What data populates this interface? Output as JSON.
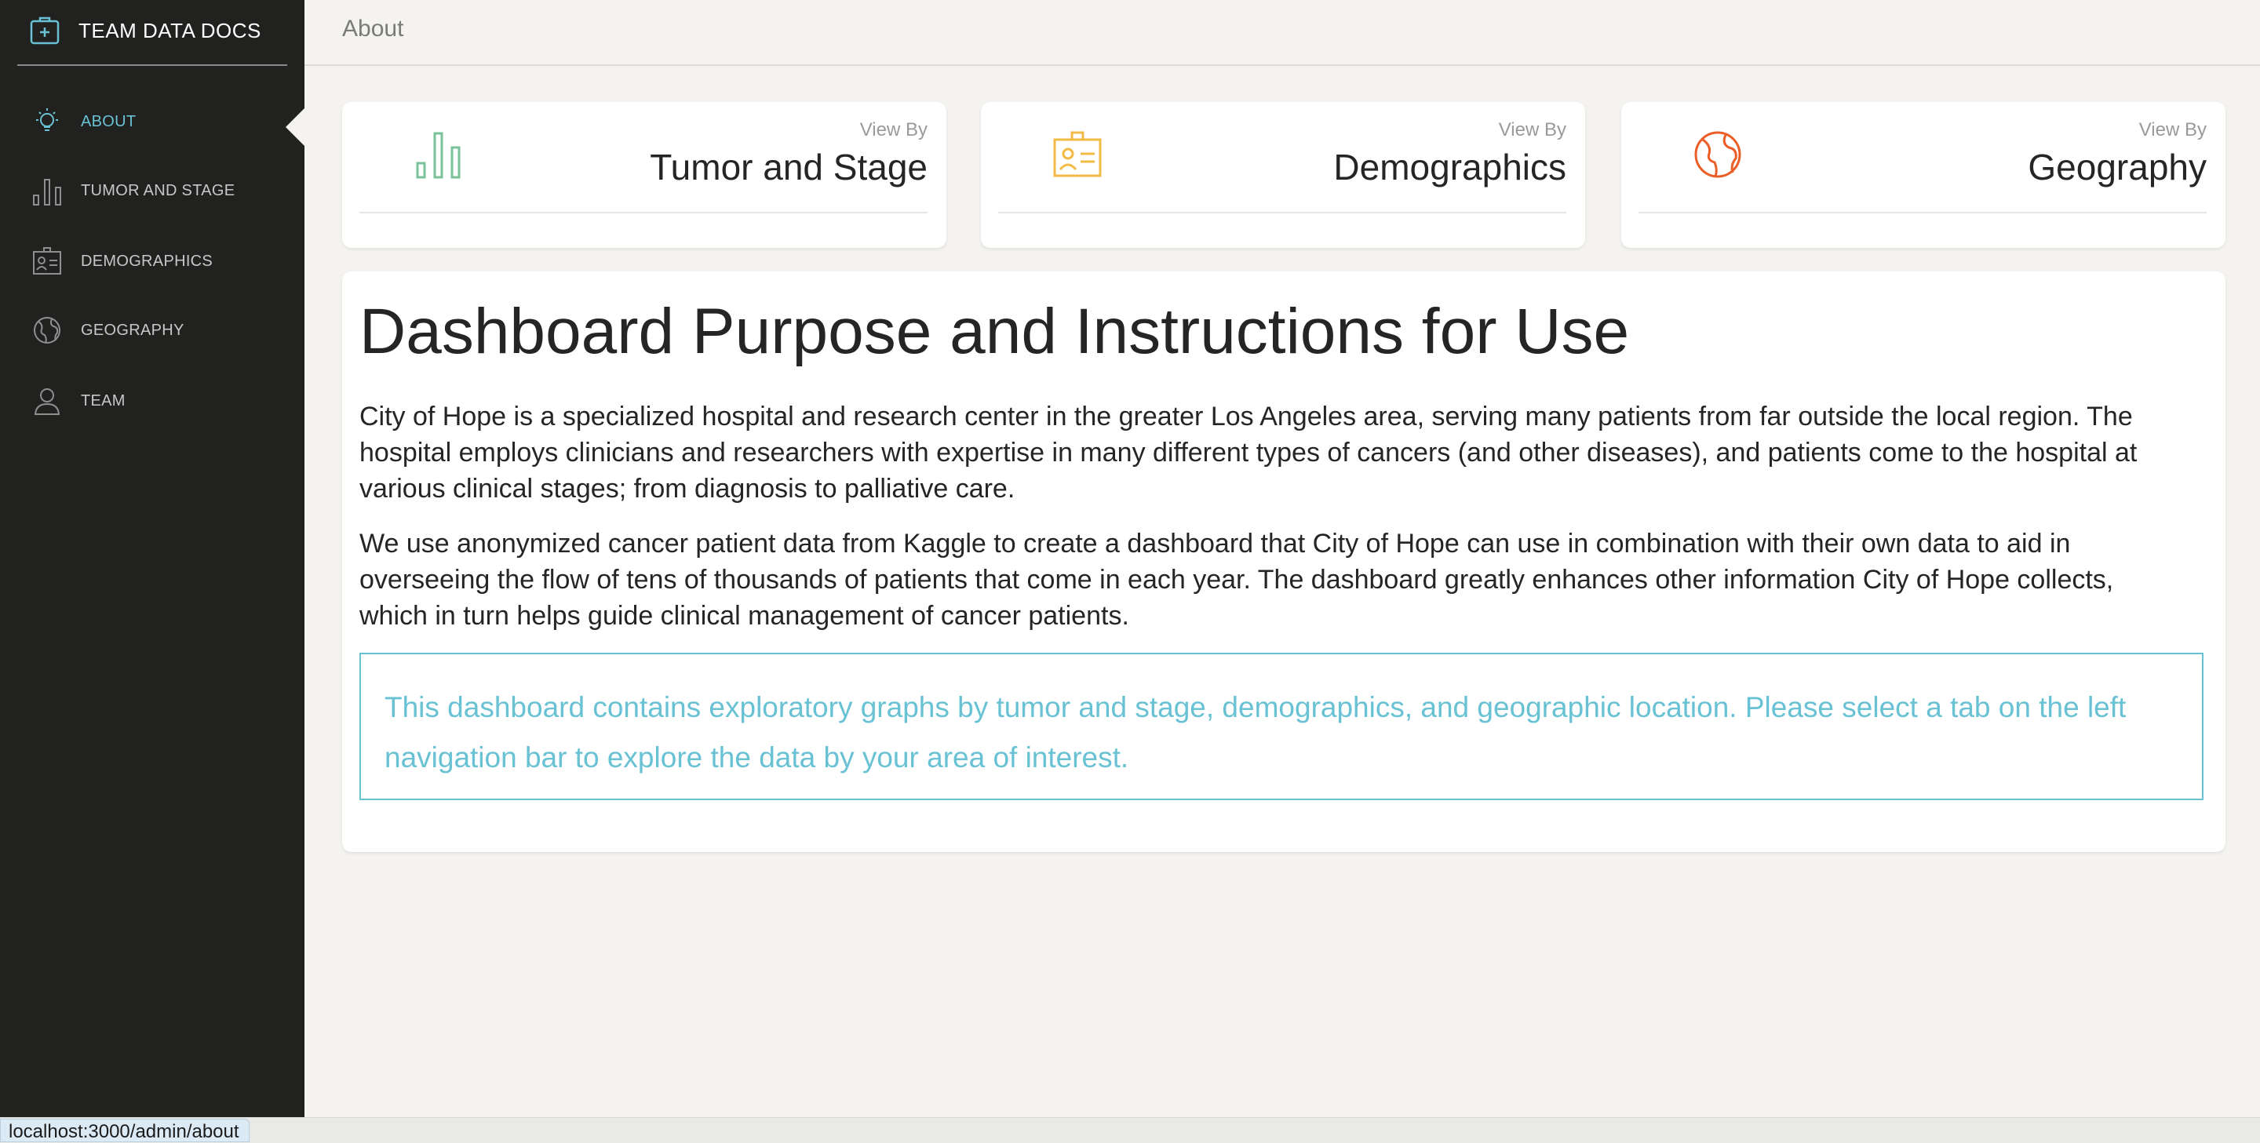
{
  "brand": {
    "name": "TEAM DATA DOCS",
    "icon": "medical-kit-icon"
  },
  "sidebar": {
    "items": [
      {
        "label": "ABOUT",
        "icon": "lightbulb-icon",
        "active": true
      },
      {
        "label": "TUMOR AND STAGE",
        "icon": "bar-chart-icon",
        "active": false
      },
      {
        "label": "DEMOGRAPHICS",
        "icon": "id-card-icon",
        "active": false
      },
      {
        "label": "GEOGRAPHY",
        "icon": "globe-icon",
        "active": false
      },
      {
        "label": "TEAM",
        "icon": "user-icon",
        "active": false
      }
    ]
  },
  "header": {
    "title": "About"
  },
  "cards": [
    {
      "subtitle": "View By",
      "title": "Tumor and Stage",
      "icon": "bar-chart-icon",
      "color": "#7ac29a"
    },
    {
      "subtitle": "View By",
      "title": "Demographics",
      "icon": "id-card-icon",
      "color": "#f3bb45"
    },
    {
      "subtitle": "View By",
      "title": "Geography",
      "icon": "globe-icon",
      "color": "#eb5e28"
    }
  ],
  "main": {
    "heading": "Dashboard Purpose and Instructions for Use",
    "paragraphs": [
      "City of Hope is a specialized hospital and research center in the greater Los Angeles area, serving many patients from far outside the local region. The hospital employs clinicians and researchers with expertise in many different types of cancers (and other diseases), and patients come to the hospital at various clinical stages; from diagnosis to palliative care.",
      "We use anonymized cancer patient data from Kaggle to create a dashboard that City of Hope can use in combination with their own data to aid in overseeing the flow of tens of thousands of patients that come in each year. The dashboard greatly enhances other information City of Hope collects, which in turn helps guide clinical management of cancer patients."
    ],
    "callout": "This dashboard contains exploratory graphs by tumor and stage, demographics, and geographic location. Please select a tab on the left navigation bar to explore the data by your area of interest."
  },
  "status_bar": {
    "url": "localhost:3000/admin/about"
  },
  "colors": {
    "accent": "#68c2d4",
    "sidebar_bg": "#212120",
    "page_bg": "#f4f3ef"
  }
}
